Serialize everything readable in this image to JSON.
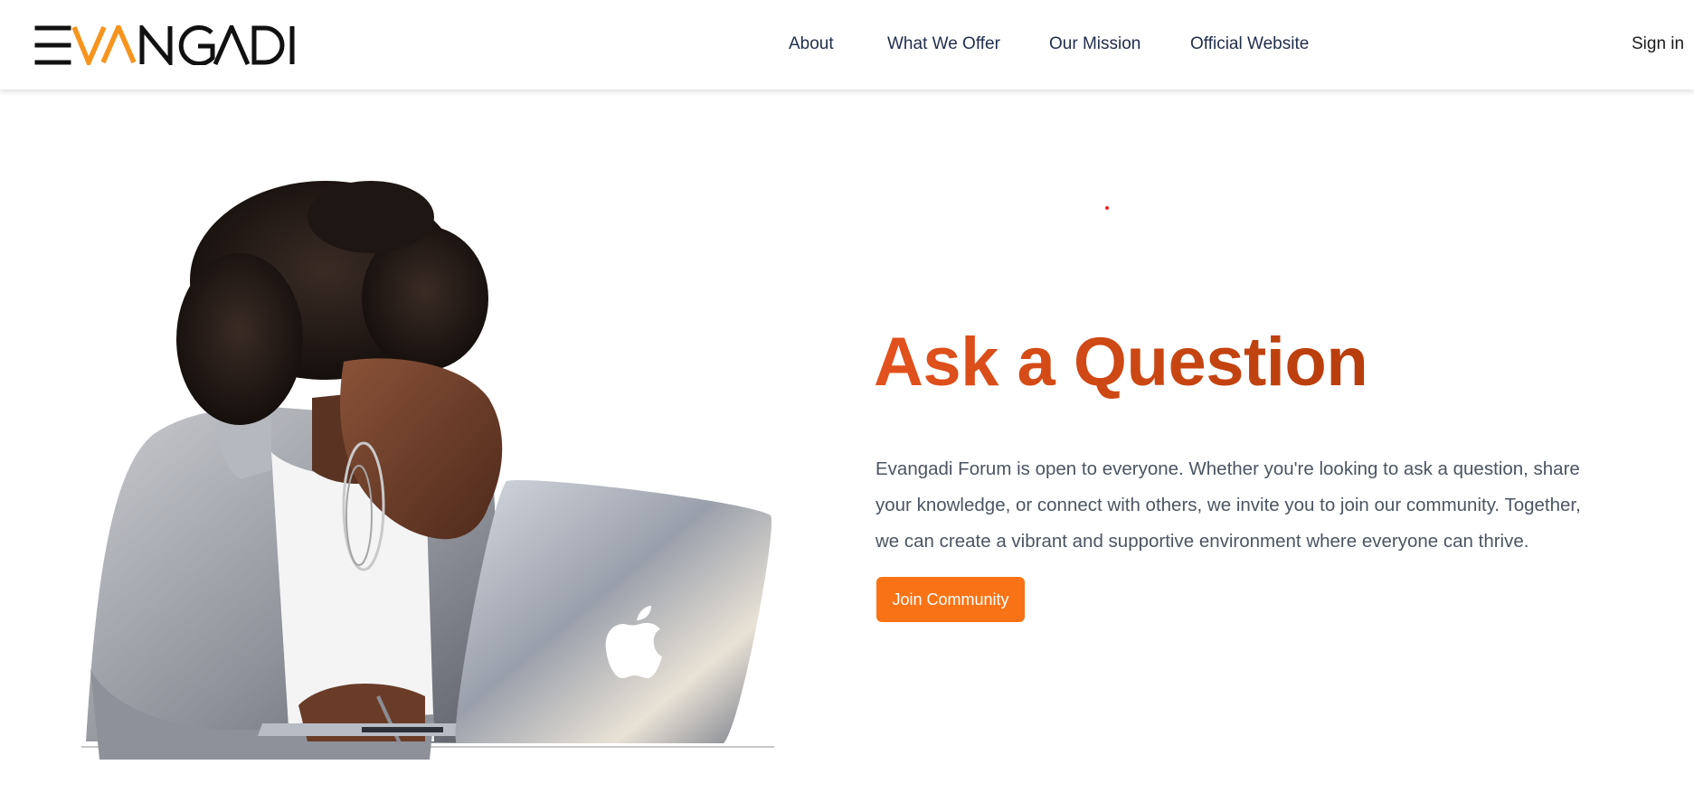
{
  "brand": {
    "logo_text": "EVANGADI",
    "logo_colors": {
      "primary": "#111111",
      "accent": "#f7941d"
    }
  },
  "nav": {
    "links": [
      {
        "label": "About"
      },
      {
        "label": "What We Offer"
      },
      {
        "label": "Our Mission"
      },
      {
        "label": "Official Website"
      }
    ],
    "signin_label": "Sign in"
  },
  "hero": {
    "title": "Ask a Question",
    "description": "Evangadi Forum is open to everyone. Whether you're looking to ask a question, share your knowledge, or connect with others, we invite you to join our community. Together, we can create a vibrant and supportive environment where everyone can thrive.",
    "cta_label": "Join Community",
    "accent_color": "#f97316",
    "title_gradient": [
      "#e4521e",
      "#a93409"
    ]
  }
}
